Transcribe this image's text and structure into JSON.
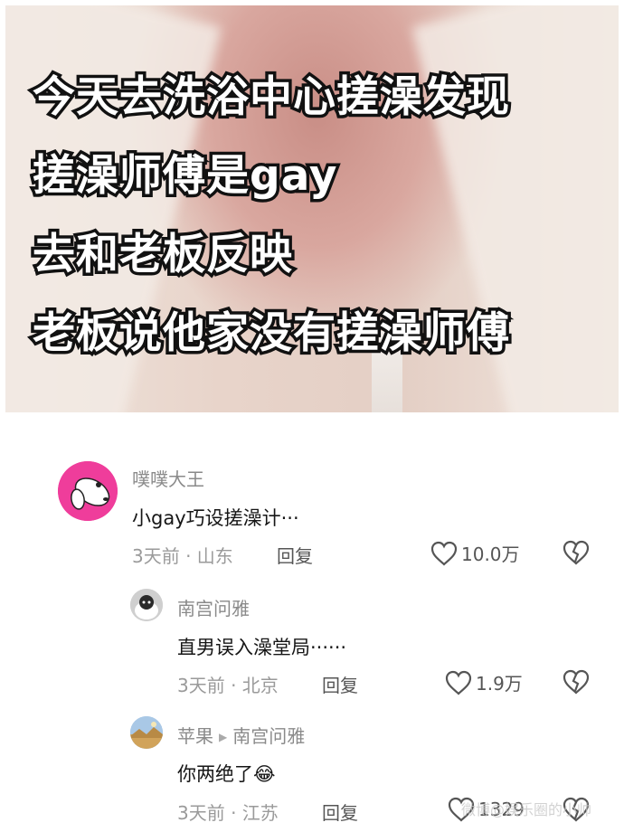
{
  "hero": {
    "caption_lines": [
      "今天去洗浴中心搓澡发现",
      "搓澡师傅是gay",
      "去和老板反映",
      "老板说他家没有搓澡师傅"
    ]
  },
  "comments": [
    {
      "username": "噗噗大王",
      "text": "小gay巧设搓澡计···",
      "time_location": "3天前 · 山东",
      "reply_label": "回复",
      "likes": "10.0万"
    },
    {
      "username": "南宫问雅",
      "text": "直男误入澡堂局······",
      "time_location": "3天前 · 北京",
      "reply_label": "回复",
      "likes": "1.9万"
    },
    {
      "username": "苹果",
      "reply_to": "南宫问雅",
      "text": "你两绝了",
      "emoji": "😂",
      "time_location": "3天前 · 江苏",
      "reply_label": "回复",
      "likes": "1329"
    }
  ],
  "watermark": "微博@娱乐圈的小帅"
}
